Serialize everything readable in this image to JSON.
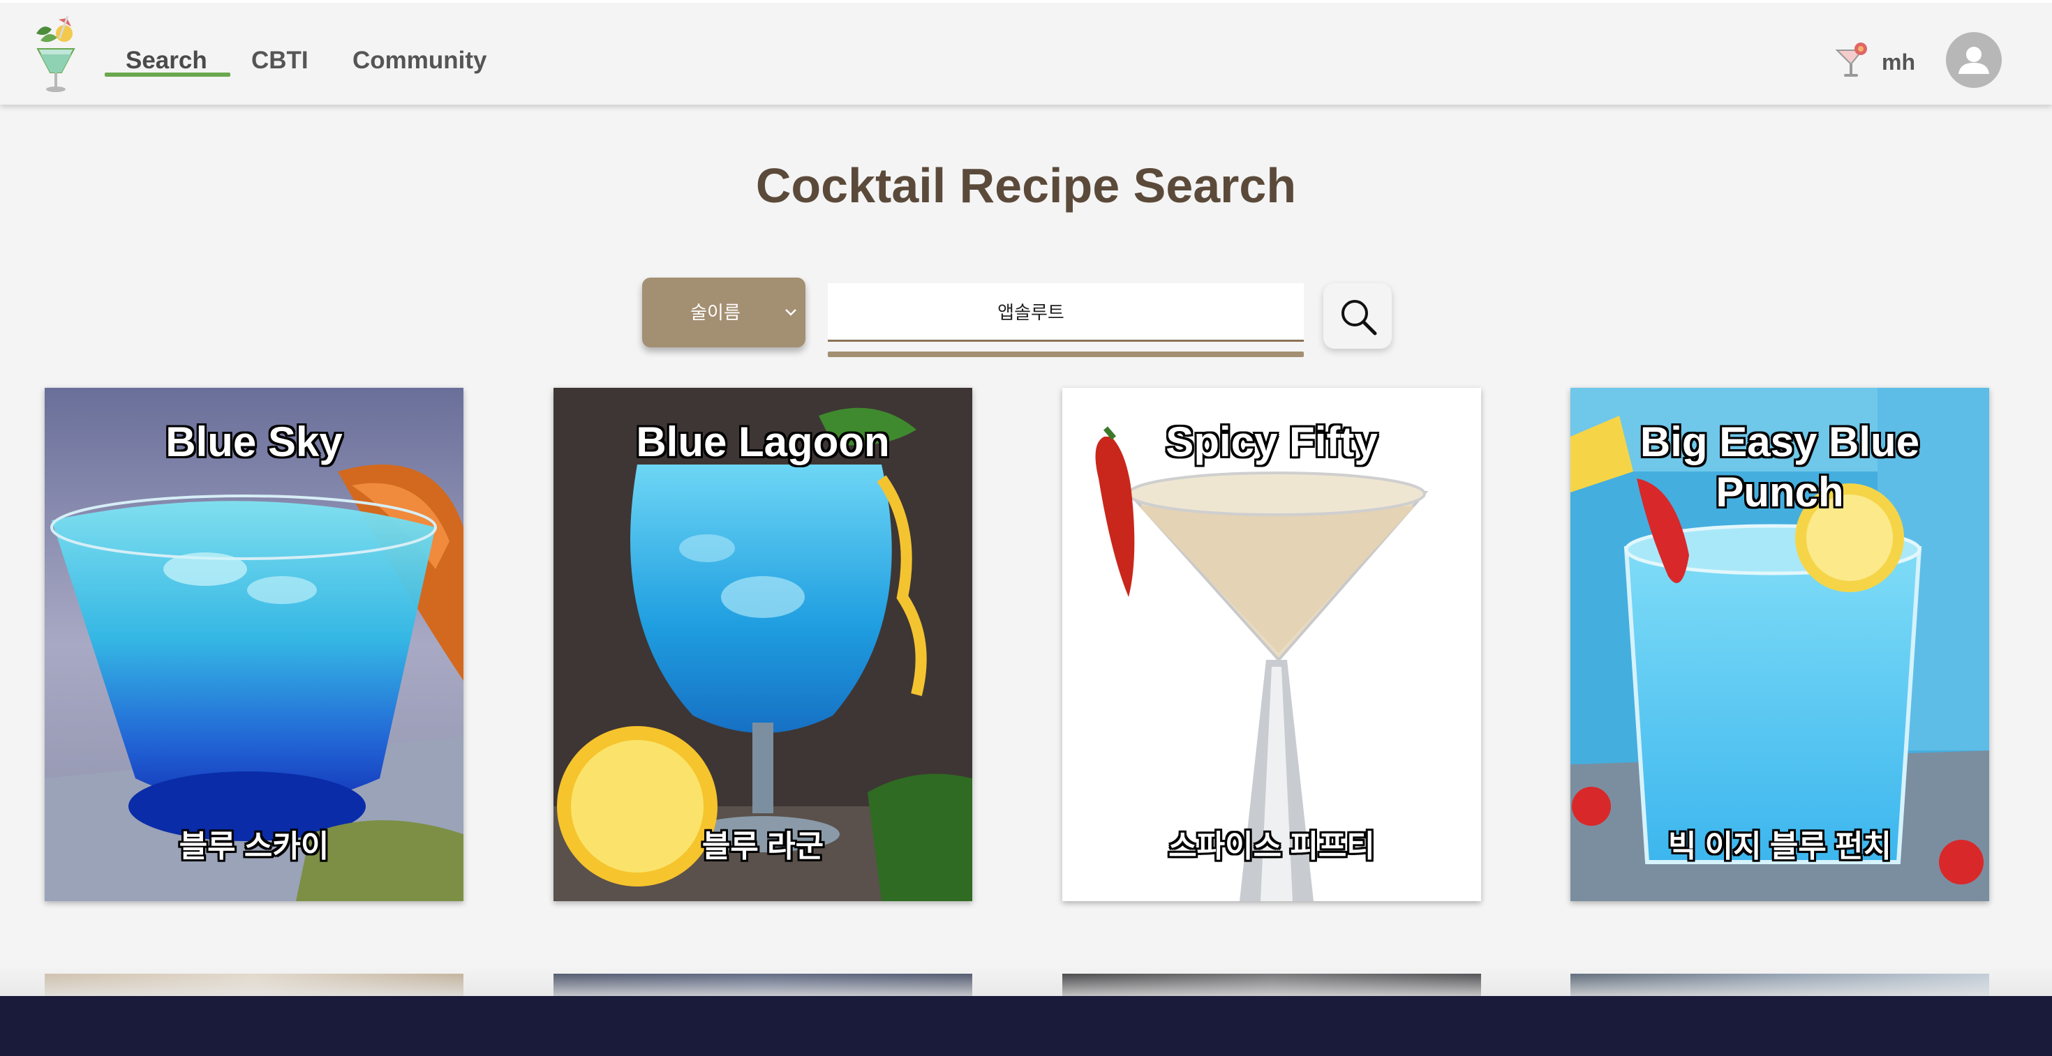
{
  "nav": {
    "links": [
      {
        "label": "Search",
        "active": true
      },
      {
        "label": "CBTI",
        "active": false
      },
      {
        "label": "Community",
        "active": false
      }
    ],
    "username": "mh",
    "accent_color": "#6aa84f"
  },
  "page": {
    "title": "Cocktail Recipe Search"
  },
  "search": {
    "category_selected": "술이름",
    "query": "앱솔루트",
    "brand_color": "#a38f72"
  },
  "results": [
    {
      "title": "Blue Sky",
      "subtitle": "블루 스카이"
    },
    {
      "title": "Blue Lagoon",
      "subtitle": "블루 라군"
    },
    {
      "title": "Spicy Fifty",
      "subtitle": "스파이스 피프티"
    },
    {
      "title": "Big Easy Blue Punch",
      "subtitle": "빅 이지 블루 펀치"
    }
  ],
  "icons": {
    "logo": "cocktail-logo-icon",
    "user_drink": "cocktail-glass-icon",
    "avatar": "user-avatar-icon",
    "search": "magnifier-icon",
    "dropdown": "chevron-down-icon"
  }
}
